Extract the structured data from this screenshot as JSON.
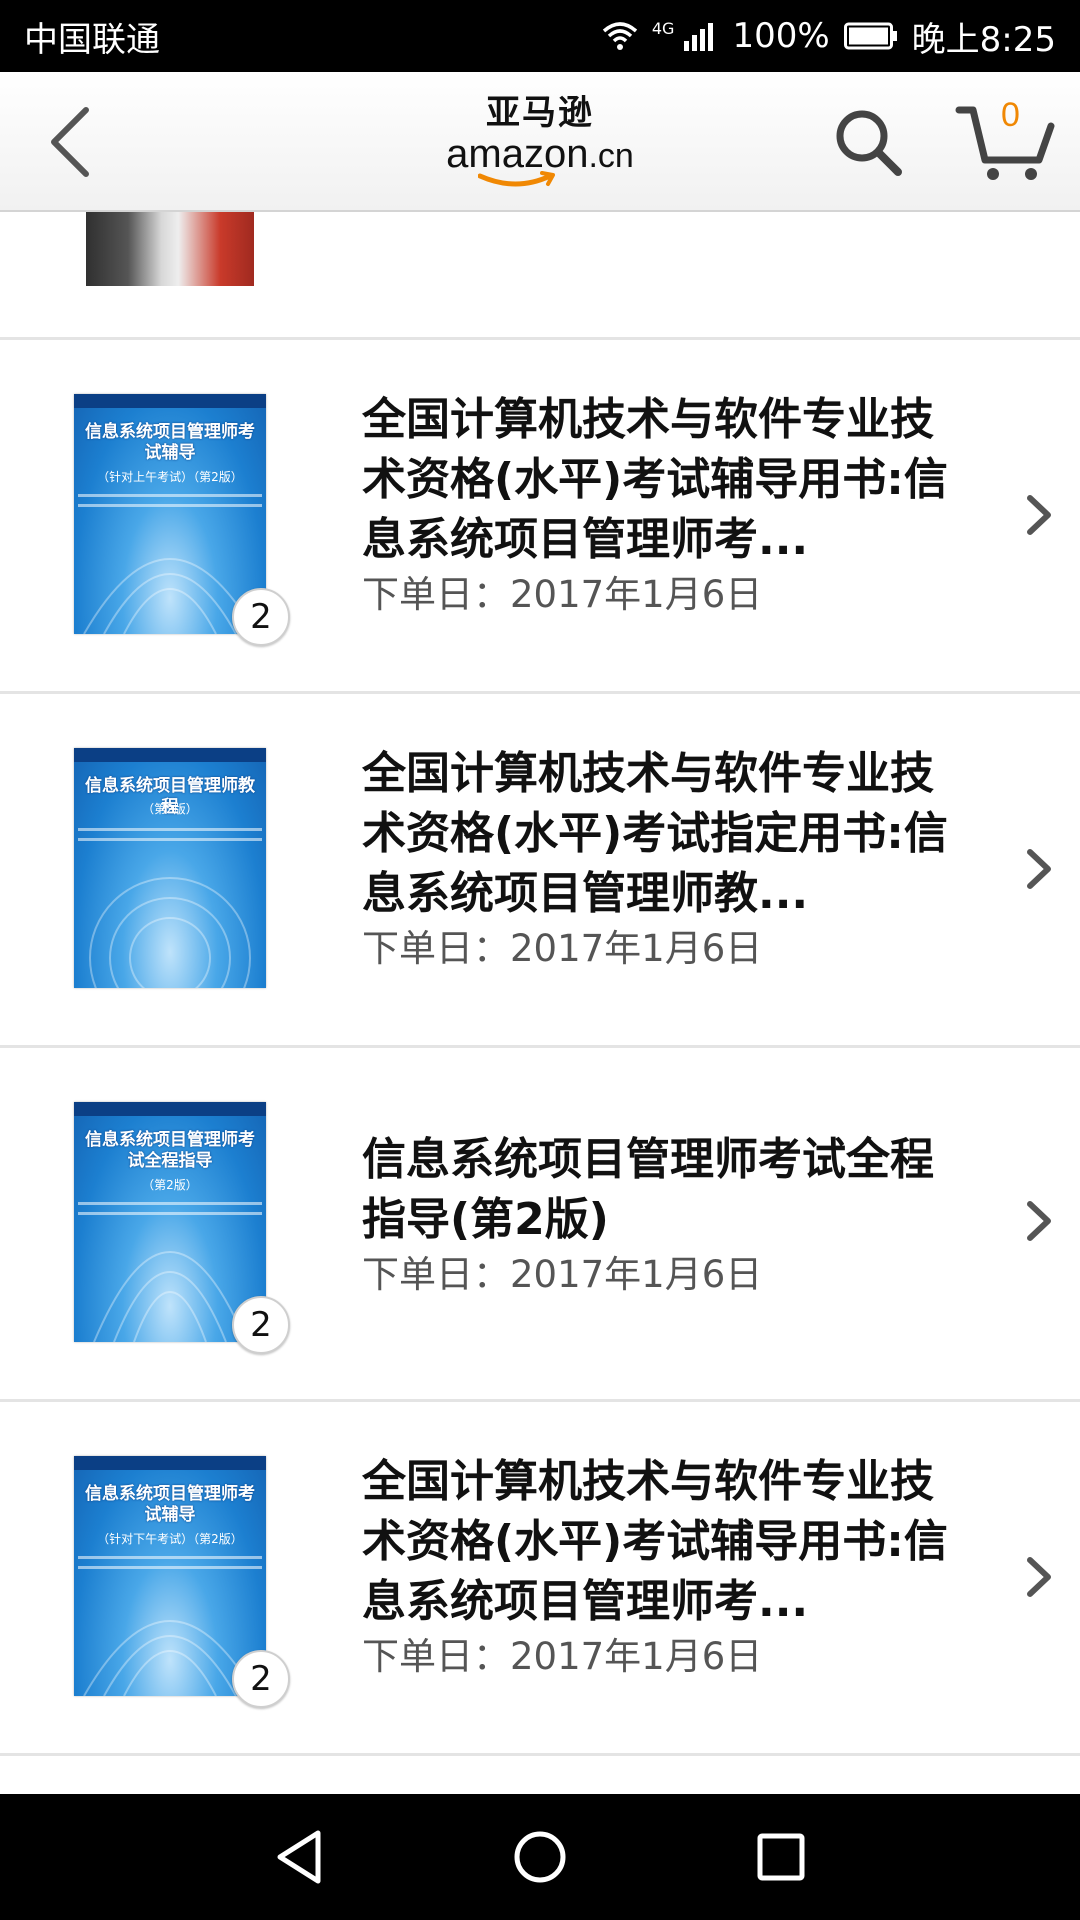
{
  "status_bar": {
    "carrier": "中国联通",
    "network": "4G",
    "battery": "100%",
    "time": "晚上8:25"
  },
  "header": {
    "logo_cn": "亚马逊",
    "logo_en": "amazon",
    "logo_suffix": ".cn",
    "cart_count": "0"
  },
  "orders": [
    {
      "title": "全国计算机技术与软件专业技术资格(水平)考试辅导用书:信息系统项目管理师考...",
      "date": "下单日：2017年1月6日",
      "quantity": "2",
      "cover": {
        "title": "信息系统项目管理师考试辅导",
        "subtitle": "（针对上午考试）（第2版）"
      }
    },
    {
      "title": "全国计算机技术与软件专业技术资格(水平)考试指定用书:信息系统项目管理师教...",
      "date": "下单日：2017年1月6日",
      "quantity": "",
      "cover": {
        "title": "信息系统项目管理师教程",
        "subtitle": "（第2版）"
      }
    },
    {
      "title": "信息系统项目管理师考试全程指导(第2版)",
      "date": "下单日：2017年1月6日",
      "quantity": "2",
      "cover": {
        "title": "信息系统项目管理师考试全程指导",
        "subtitle": "（第2版）"
      }
    },
    {
      "title": "全国计算机技术与软件专业技术资格(水平)考试辅导用书:信息系统项目管理师考...",
      "date": "下单日：2017年1月6日",
      "quantity": "2",
      "cover": {
        "title": "信息系统项目管理师考试辅导",
        "subtitle": "（针对下午考试）（第2版）"
      }
    }
  ],
  "colors": {
    "accent": "#f08804",
    "cover_blue": "#1c7fd0",
    "divider": "#e4e4e4"
  }
}
